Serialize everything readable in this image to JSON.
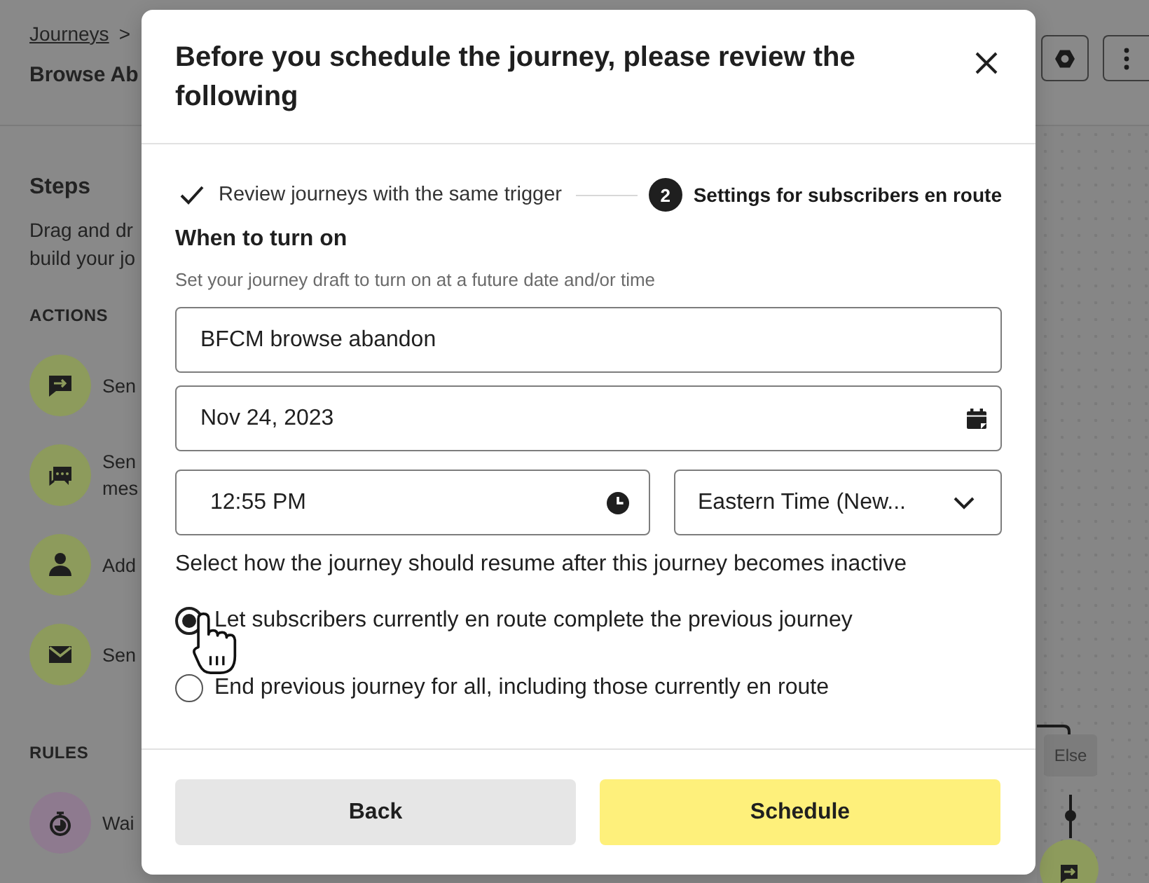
{
  "page": {
    "breadcrumb": {
      "link": "Journeys",
      "separator": ">"
    },
    "title": "Browse Ab"
  },
  "sidebar": {
    "heading": "Steps",
    "description": [
      "Drag and dr",
      "build your jo"
    ],
    "sections": [
      {
        "label": "ACTIONS",
        "items": [
          {
            "kind": "sms",
            "lines": [
              "Sen"
            ]
          },
          {
            "kind": "chat",
            "lines": [
              "Sen",
              "mes"
            ]
          },
          {
            "kind": "profile",
            "lines": [
              "Add"
            ]
          },
          {
            "kind": "email",
            "lines": [
              "Sen"
            ]
          }
        ]
      },
      {
        "label": "RULES",
        "items": [
          {
            "kind": "wait",
            "lines": [
              "Wai"
            ]
          }
        ]
      }
    ]
  },
  "canvas": {
    "branch_label": "Else"
  },
  "dialog": {
    "title": "Before you schedule the journey, please review the following",
    "steps": [
      {
        "label": "Review journeys with the same trigger",
        "completed": true,
        "selected": false
      },
      {
        "number": "2",
        "label": "Settings for subscribers en route",
        "completed": false,
        "selected": true
      }
    ],
    "section_title": "When to turn on",
    "hint": "Set your journey draft to turn on at a future date and/or time",
    "name_field": {
      "value": "BFCM browse abandon"
    },
    "date_field": {
      "value": "Nov 24, 2023"
    },
    "time_field": {
      "value": "12:55 PM"
    },
    "timezone_select": {
      "value": "Eastern Time (New..."
    },
    "resume_prompt": "Select how the journey should resume after this journey becomes inactive",
    "resume_options": [
      {
        "label": "Let subscribers currently en route complete the previous journey",
        "selected": true
      },
      {
        "label": "End previous journey for all, including those currently en route",
        "selected": false
      }
    ],
    "buttons": [
      {
        "kind": "secondary",
        "label": "Back"
      },
      {
        "kind": "primary",
        "label": "Schedule"
      }
    ]
  }
}
